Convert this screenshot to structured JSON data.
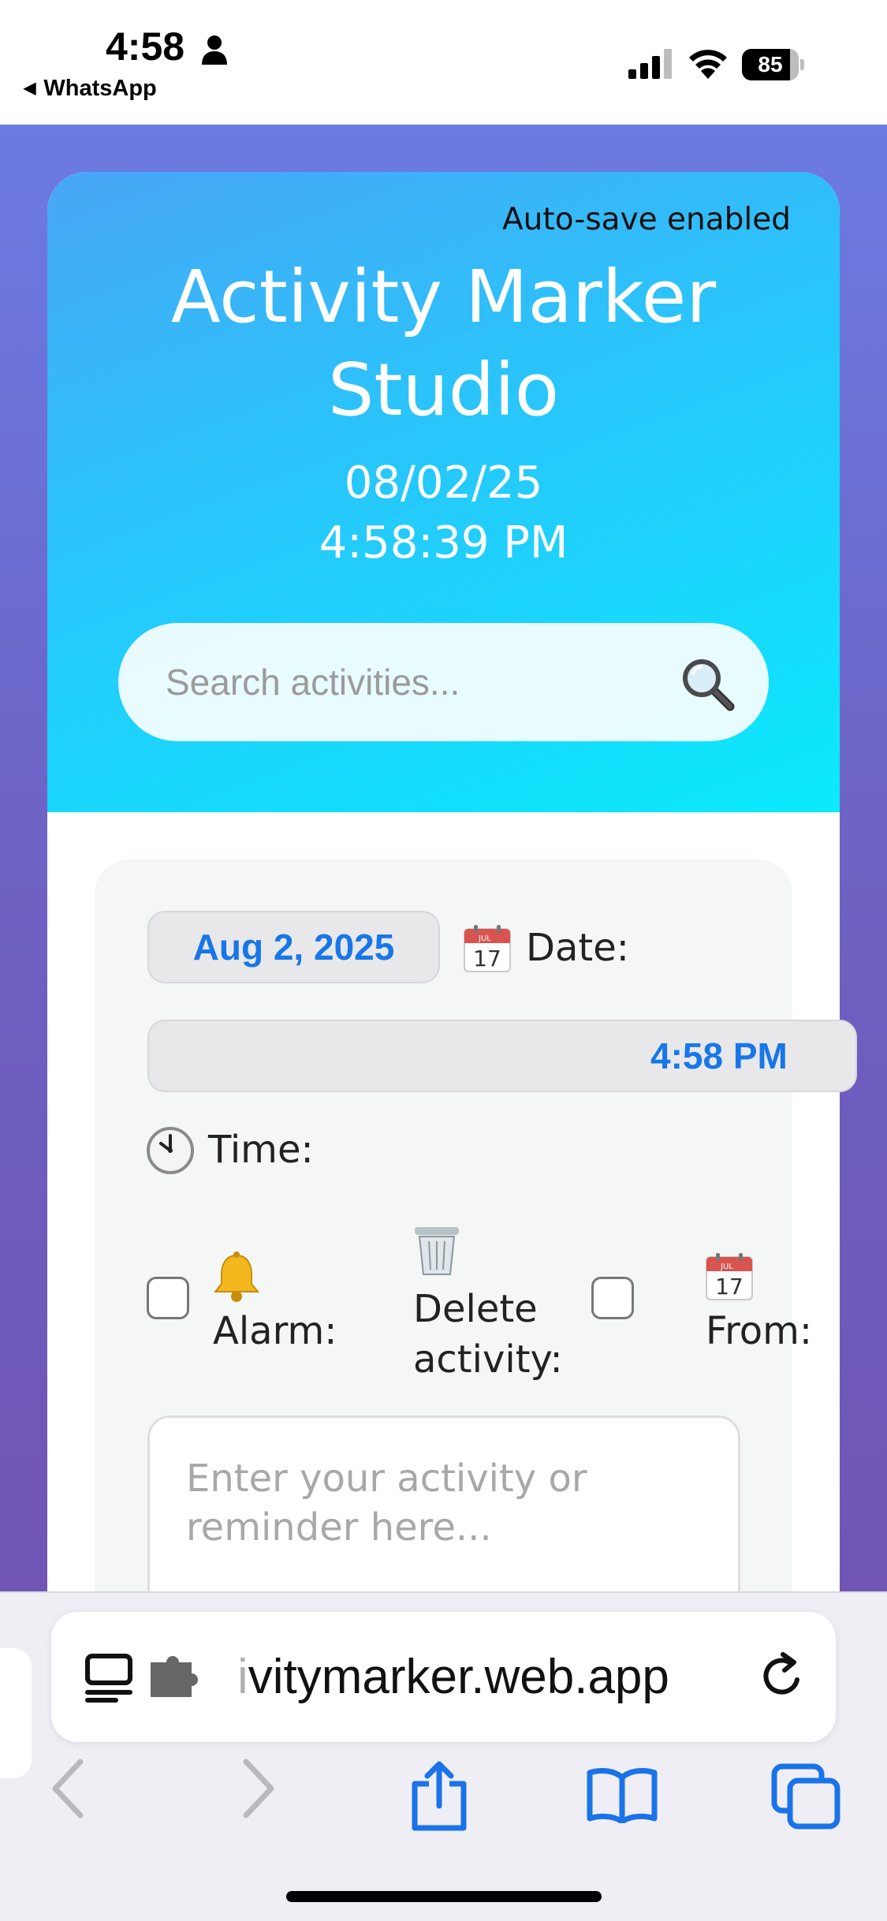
{
  "status_bar": {
    "time": "4:58",
    "back_app": "WhatsApp",
    "battery_percent": "85",
    "battery_level": 0.85,
    "icons": [
      "person-icon",
      "signal-icon",
      "wifi-icon",
      "battery-icon"
    ]
  },
  "header": {
    "autosave": "Auto-save enabled",
    "title": "Activity Marker Studio",
    "date": "08/02/25",
    "time": "4:58:39 PM",
    "colors": {
      "gradient_start": "#48a6f6",
      "gradient_end": "#0aeafd"
    }
  },
  "search": {
    "placeholder": "Search activities...",
    "icon": "magnifier-icon"
  },
  "form": {
    "date_value": "Aug 2, 2025",
    "date_label": "Date:",
    "time_value": "4:58 PM",
    "time_label": "Time:",
    "alarm_label": "Alarm:",
    "delete_label": "Delete activity:",
    "from_label": "From:",
    "activity_placeholder": "Enter your activity or reminder here...",
    "accent_color": "#1877e8"
  },
  "browser": {
    "url_faded": "i",
    "url": "vitymarker.web.app",
    "icons": [
      "reader-icon",
      "extension-icon",
      "reload-icon",
      "back-icon",
      "forward-icon",
      "share-icon",
      "bookmarks-icon",
      "tabs-icon"
    ]
  }
}
